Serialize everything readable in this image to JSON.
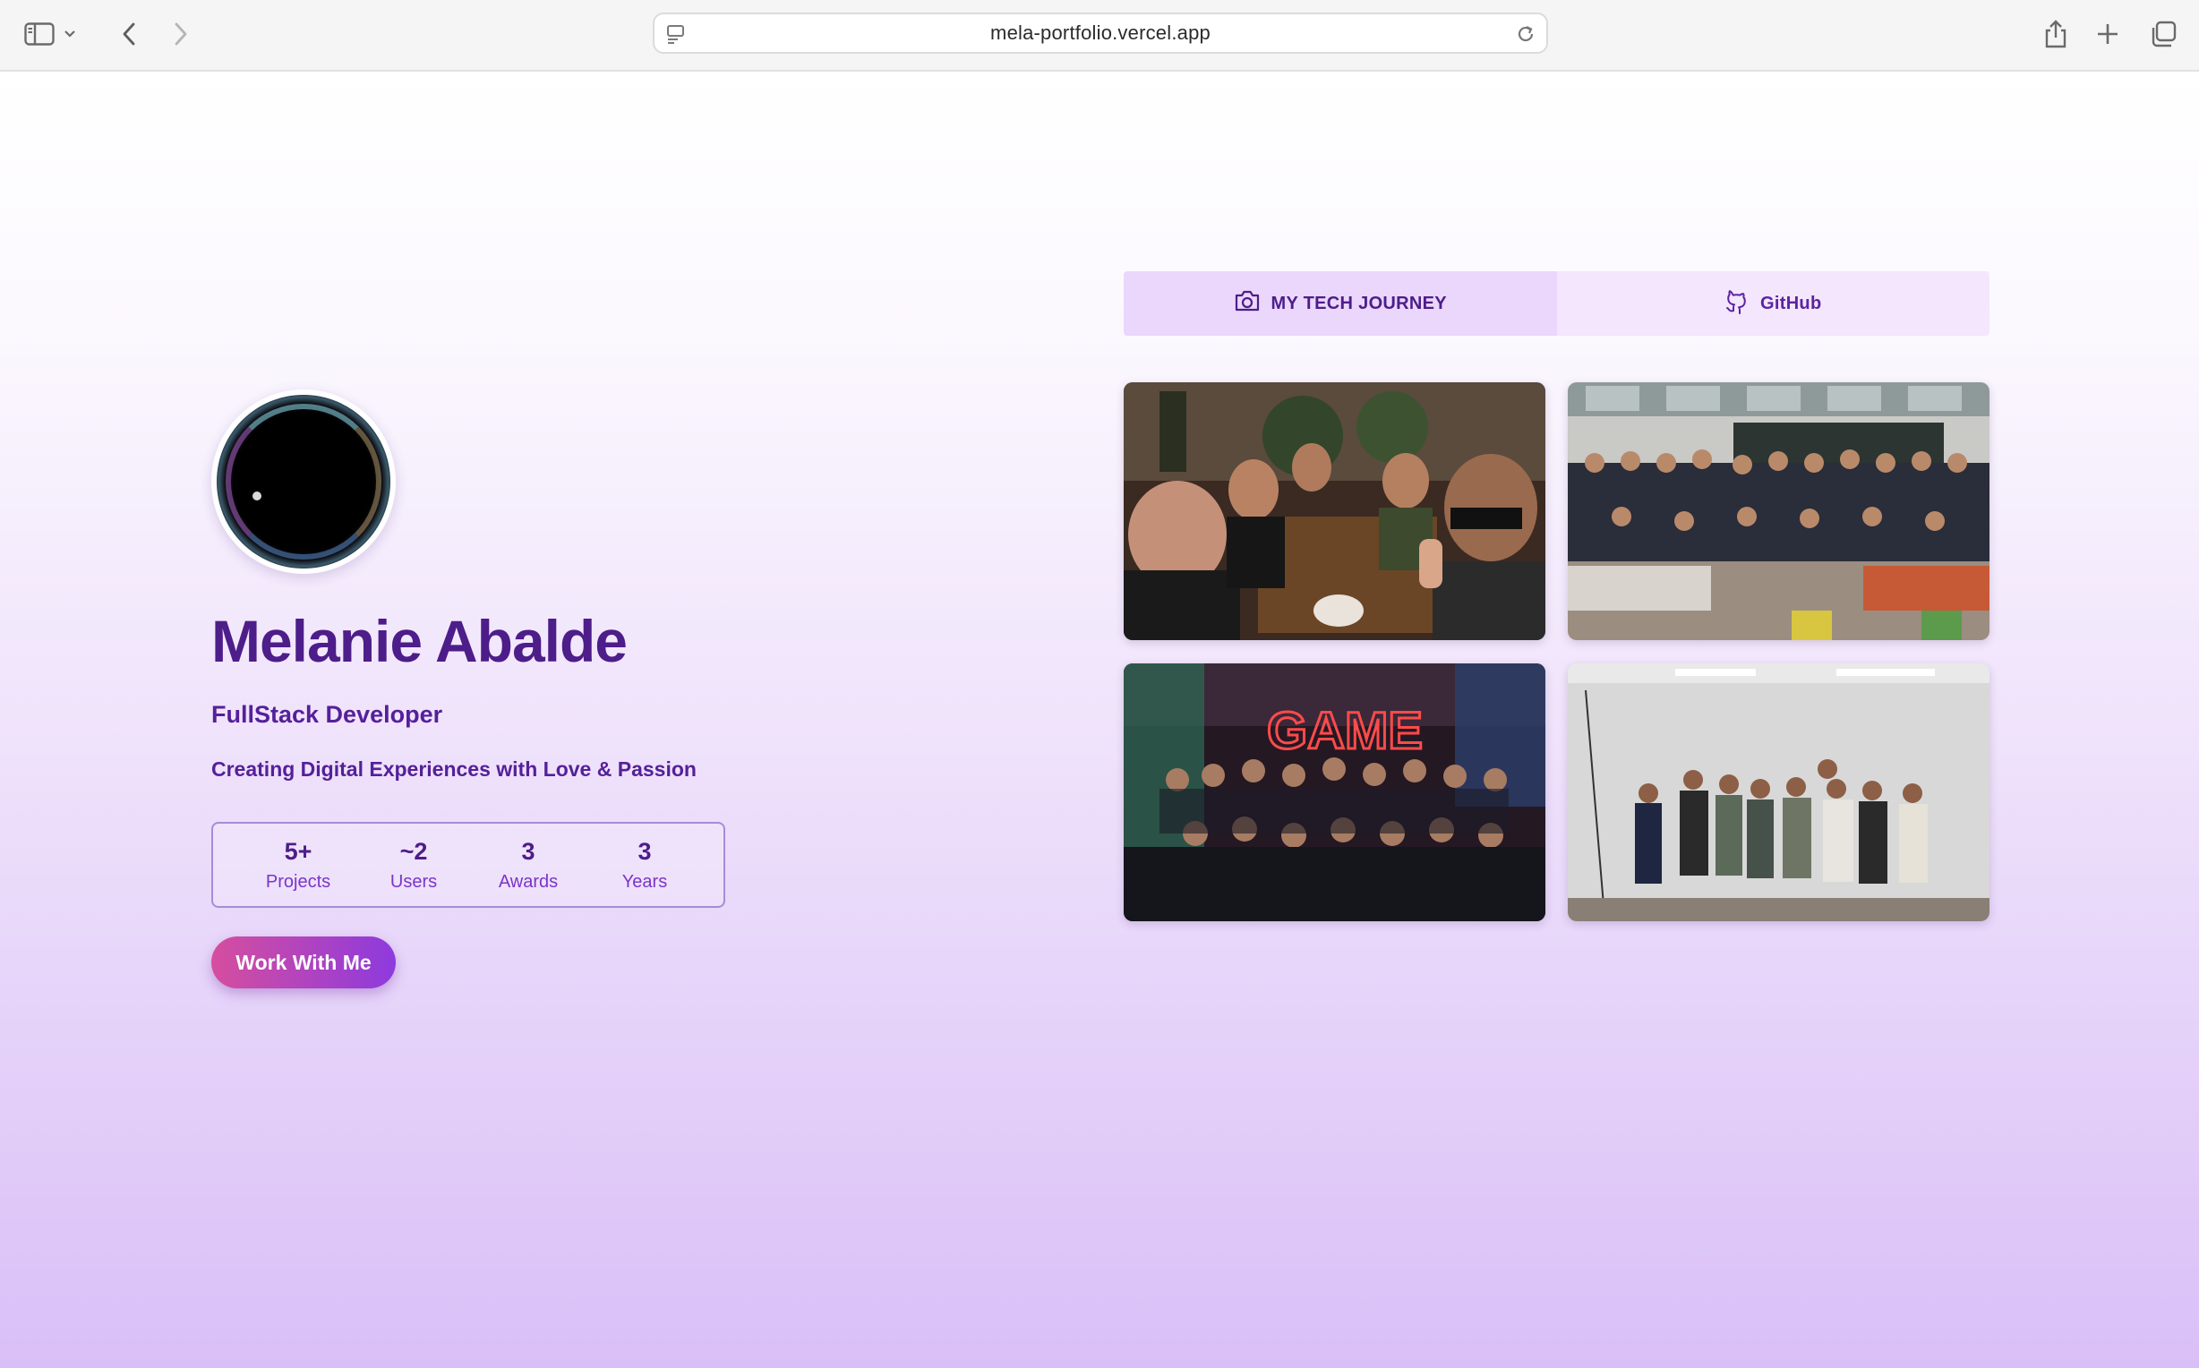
{
  "browser": {
    "url": "mela-portfolio.vercel.app",
    "icons": [
      "sidebar-icon",
      "chevron-down-icon",
      "back-icon",
      "forward-icon",
      "page-icon",
      "reload-icon",
      "share-icon",
      "plus-icon",
      "tabs-icon"
    ]
  },
  "hero": {
    "name": "Melanie Abalde",
    "role": "FullStack Developer",
    "tagline": "Creating Digital Experiences with Love & Passion",
    "cta": "Work With Me",
    "stats": [
      {
        "value": "5+",
        "label": "Projects"
      },
      {
        "value": "~2",
        "label": "Users"
      },
      {
        "value": "3",
        "label": "Awards"
      },
      {
        "value": "3",
        "label": "Years"
      }
    ]
  },
  "tabs": [
    {
      "label": "MY TECH JOURNEY",
      "icon": "camera-icon",
      "active": true
    },
    {
      "label": "GitHub",
      "icon": "github-icon",
      "active": false
    }
  ],
  "gallery": {
    "photos": [
      {
        "name": "cafe-group-selfie"
      },
      {
        "name": "classroom-group-photo"
      },
      {
        "name": "game-neon-event-photo"
      },
      {
        "name": "white-room-group-photo"
      }
    ]
  },
  "colors": {
    "primary": "#4d1d8a",
    "accent_start": "#d64e9e",
    "accent_end": "#8d3ade",
    "tab_active": "#ead7fb"
  }
}
